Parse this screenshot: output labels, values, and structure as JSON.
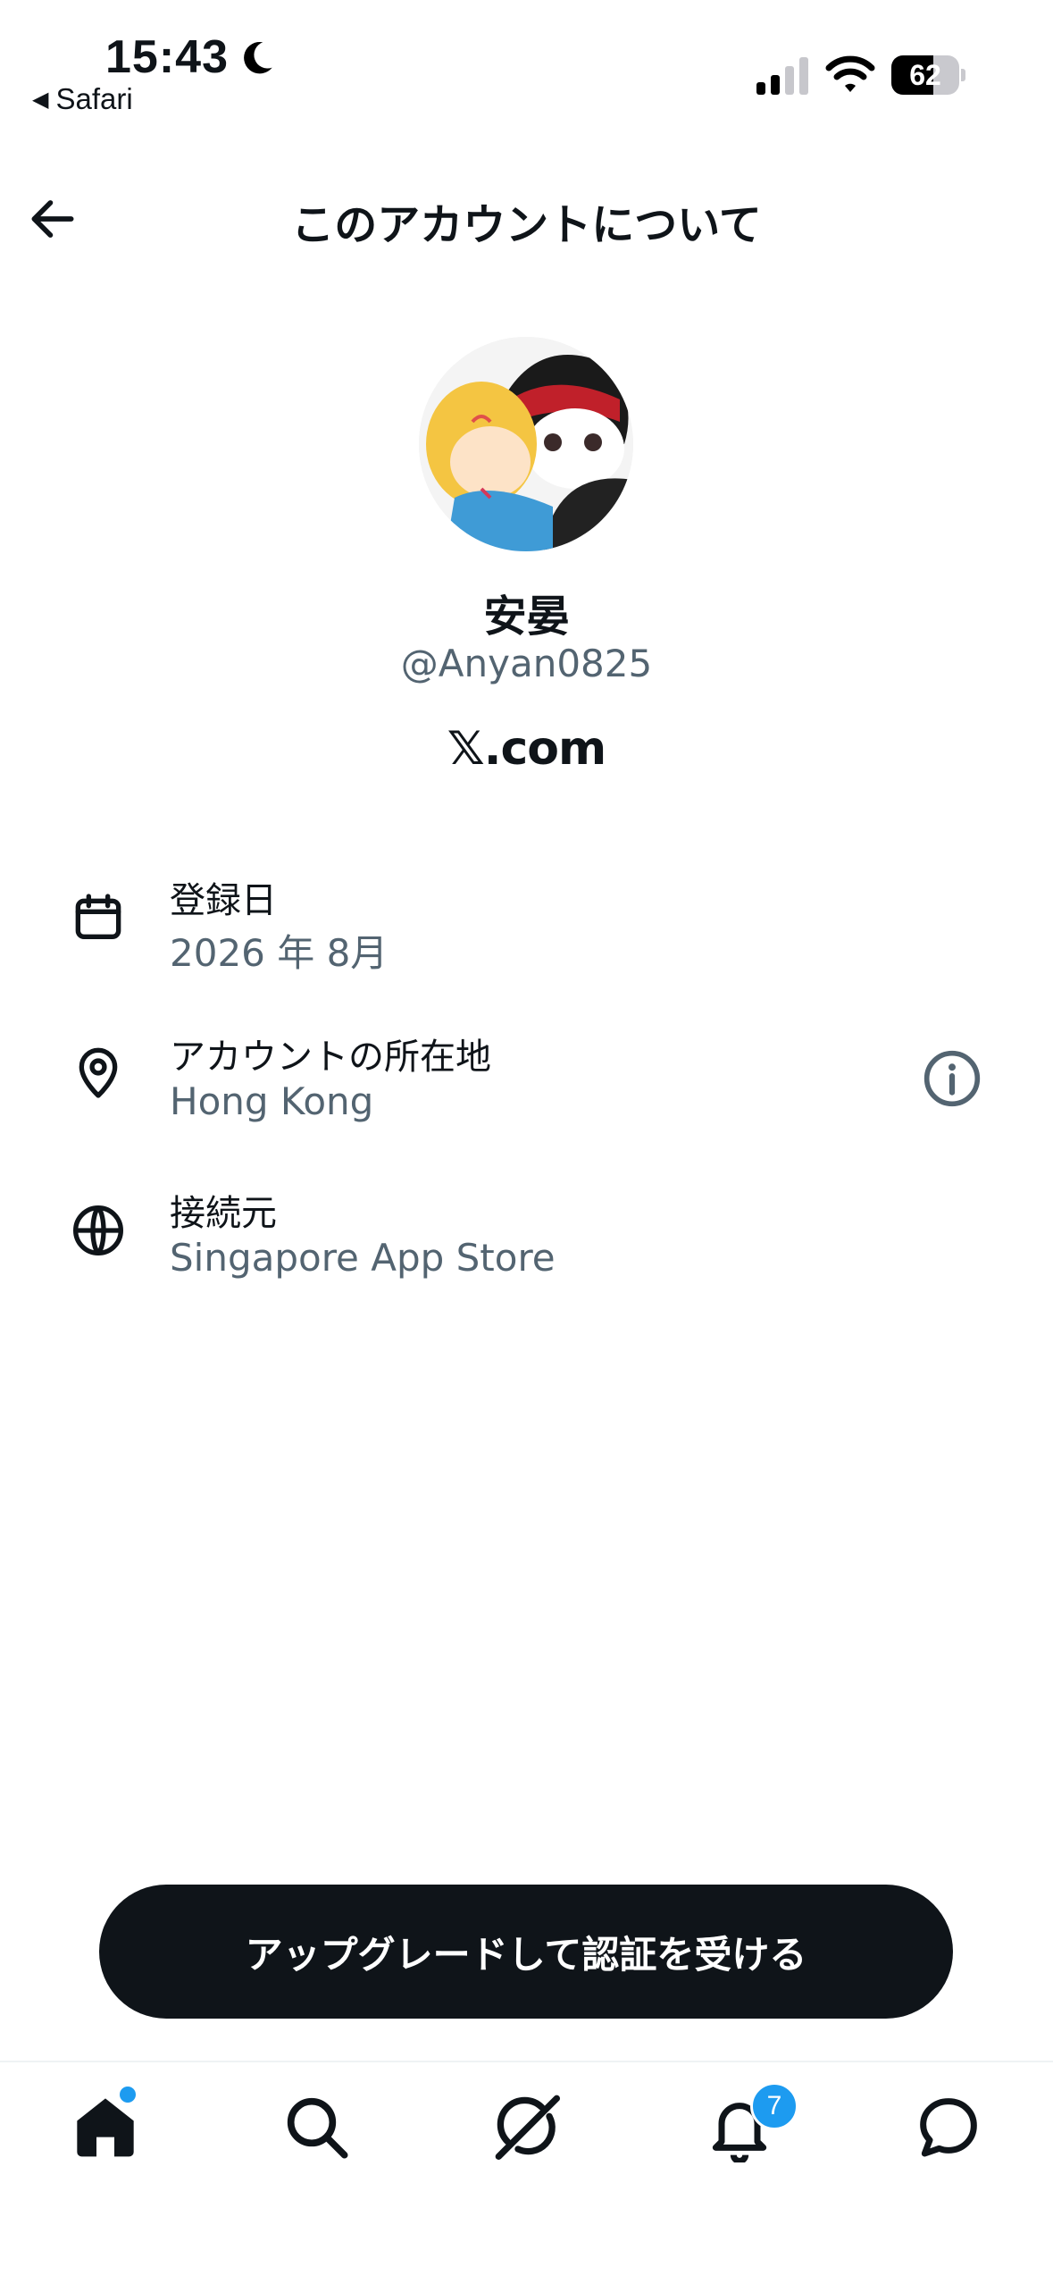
{
  "status_bar": {
    "time": "15:43",
    "back_app": "Safari",
    "battery_level": "62",
    "battery_fraction": 0.62,
    "icons": [
      "moon-icon",
      "signal-icon",
      "wifi-icon",
      "battery-icon"
    ]
  },
  "header": {
    "title": "このアカウントについて",
    "back_icon": "arrow-left-icon"
  },
  "profile": {
    "display_name": "安晏",
    "handle": "@Anyan0825",
    "platform": "𝕏.com"
  },
  "details": [
    {
      "icon": "calendar-icon",
      "label": "登録日",
      "value": "2026 年 8月"
    },
    {
      "icon": "location-pin-icon",
      "label": "アカウントの所在地",
      "value": "Hong Kong",
      "trailing_icon": "info-icon"
    },
    {
      "icon": "globe-icon",
      "label": "接続元",
      "value": "Singapore App Store"
    }
  ],
  "upgrade_button": {
    "label": "アップグレードして認証を受ける"
  },
  "tab_bar": {
    "items": [
      "home-icon",
      "search-icon",
      "grok-icon",
      "notifications-icon",
      "messages-icon"
    ],
    "notification_count": "7"
  },
  "colors": {
    "text_primary": "#0f1419",
    "text_secondary": "#536471",
    "accent": "#1d9bf0",
    "button_bg": "#0f1419"
  }
}
